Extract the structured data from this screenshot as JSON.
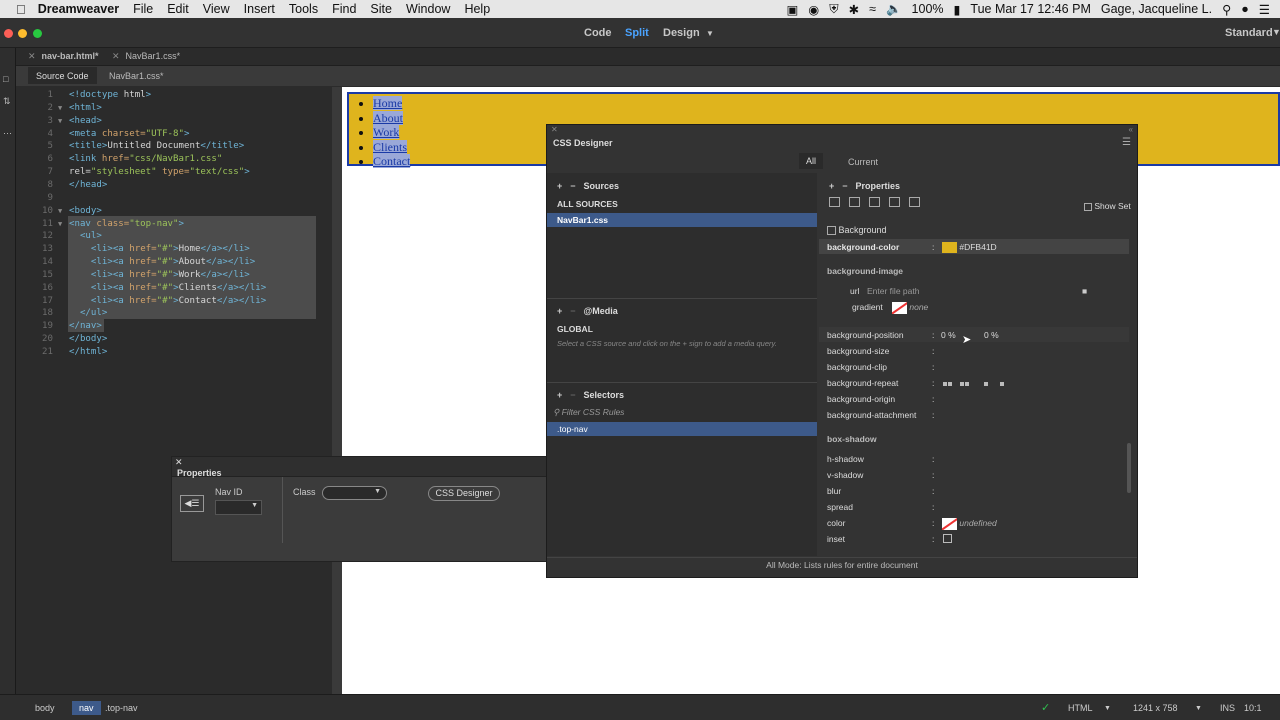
{
  "menubar": {
    "app_name": "Dreamweaver",
    "items": [
      "File",
      "Edit",
      "View",
      "Insert",
      "Tools",
      "Find",
      "Site",
      "Window",
      "Help"
    ],
    "battery": "100%",
    "datetime": "Tue Mar 17  12:46 PM",
    "user": "Gage, Jacqueline L."
  },
  "toolbar": {
    "views": [
      "Code",
      "Split",
      "Design"
    ],
    "active_view": "Split",
    "workspace": "Standard"
  },
  "doc_tabs": [
    {
      "label": "nav-bar.html*"
    },
    {
      "label": "NavBar1.css*"
    }
  ],
  "source_bar": {
    "items": [
      "Source Code",
      "NavBar1.css*"
    ]
  },
  "code_lines": [
    "<!doctype html>",
    "<html>",
    "<head>",
    "<meta charset=\"UTF-8\">",
    "<title>Untitled Document</title>",
    "<link href=\"css/NavBar1.css\"",
    "rel=\"stylesheet\" type=\"text/css\">",
    "</head>",
    "",
    "<body>",
    "<nav class=\"top-nav\">",
    "  <ul>",
    "    <li><a href=\"#\">Home</a></li>",
    "    <li><a href=\"#\">About</a></li>",
    "    <li><a href=\"#\">Work</a></li>",
    "    <li><a href=\"#\">Clients</a></li>",
    "    <li><a href=\"#\">Contact</a></li>",
    "  </ul>",
    "</nav>",
    "</body>",
    "</html>",
    ""
  ],
  "line_numbers": [
    "1",
    "2",
    "3",
    "4",
    "5",
    "6",
    "7",
    "8",
    "9",
    "10",
    "11",
    "12",
    "13",
    "14",
    "15",
    "16",
    "17",
    "18",
    "19",
    "20",
    "21"
  ],
  "design_nav": {
    "links": [
      "Home",
      "About",
      "Work",
      "Clients",
      "Contact"
    ],
    "bg_color": "#DFB41D"
  },
  "properties_panel": {
    "title": "Properties",
    "nav_id_label": "Nav ID",
    "class_label": "Class",
    "css_designer_button": "CSS Designer"
  },
  "css_designer": {
    "title": "CSS Designer",
    "modes": [
      "All",
      "Current"
    ],
    "sources_label": "Sources",
    "sources": [
      "ALL SOURCES",
      "NavBar1.css"
    ],
    "media_label": "@Media",
    "global_label": "GLOBAL",
    "media_hint": "Select a CSS source and click on the + sign to add a media query.",
    "selectors_label": "Selectors",
    "filter_placeholder": "Filter CSS Rules",
    "selectors": [
      ".top-nav"
    ],
    "properties_label": "Properties",
    "show_set_label": "Show Set",
    "background_section": "Background",
    "bg_color_label": "background-color",
    "bg_color_value": "#DFB41D",
    "bg_image_label": "background-image",
    "url_label": "url",
    "url_placeholder": "Enter file path",
    "gradient_label": "gradient",
    "gradient_value": "none",
    "bg_position_label": "background-position",
    "bg_position_x": "0 %",
    "bg_position_y": "0 %",
    "bg_size_label": "background-size",
    "bg_clip_label": "background-clip",
    "bg_repeat_label": "background-repeat",
    "bg_origin_label": "background-origin",
    "bg_attachment_label": "background-attachment",
    "box_shadow_label": "box-shadow",
    "h_shadow_label": "h-shadow",
    "v_shadow_label": "v-shadow",
    "blur_label": "blur",
    "spread_label": "spread",
    "color_label": "color",
    "color_value": "undefined",
    "inset_label": "inset",
    "footer": "All Mode: Lists rules for entire document"
  },
  "status_bar": {
    "breadcrumbs": [
      "body",
      "nav",
      ".top-nav"
    ],
    "doc_type": "HTML",
    "size": "1241 x 758",
    "mode": "INS",
    "position": "10:1"
  }
}
